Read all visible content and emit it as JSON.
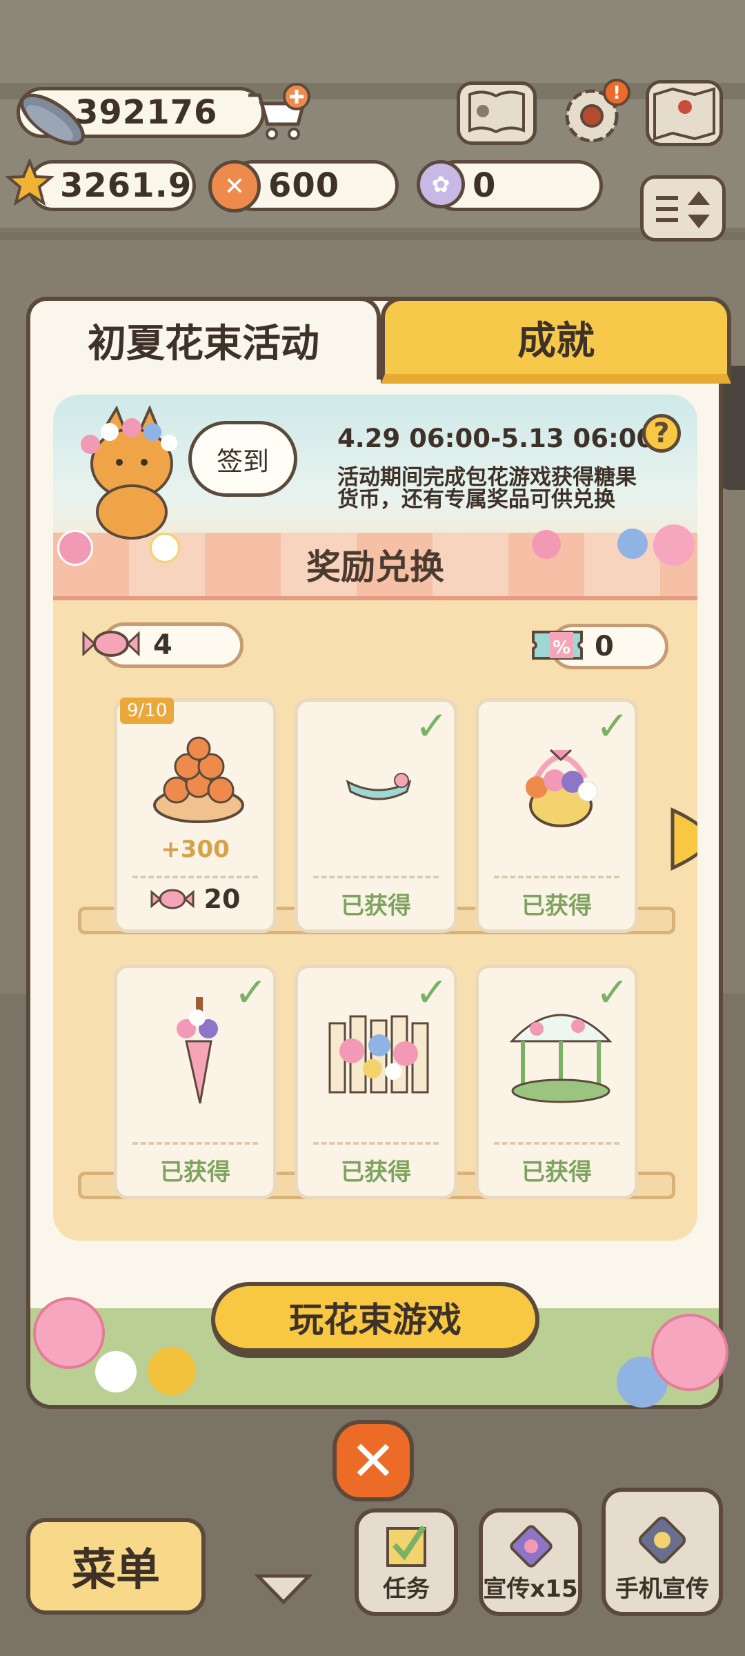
{
  "hud": {
    "fish": "392176",
    "stars": "3261.9",
    "coins": "600",
    "paws": "0"
  },
  "tabs": {
    "event": "初夏花束活动",
    "achievements": "成就"
  },
  "banner": {
    "checkin": "签到",
    "date_range": "4.29 06:00-5.13 06:00",
    "description": "活动期间完成包花游戏获得糖果货币，还有专属奖品可供兑换",
    "help": "?"
  },
  "exchange": {
    "title": "奖励兑换",
    "candy_count": "4",
    "ticket_count": "0",
    "items": [
      {
        "badge": "9/10",
        "reward": "+300",
        "price": "20",
        "status": ""
      },
      {
        "status": "已获得"
      },
      {
        "status": "已获得"
      },
      {
        "status": "已获得"
      },
      {
        "status": "已获得"
      },
      {
        "status": "已获得"
      }
    ]
  },
  "play_button": "玩花束游戏",
  "bottom": {
    "menu": "菜单",
    "tasks": "任务",
    "promo": "宣传x15",
    "phone_promo": "手机宣传"
  },
  "colors": {
    "accent": "#f8c842",
    "panel": "#fbf6ec",
    "border": "#5b4a3c",
    "obtained": "#7da35f"
  }
}
